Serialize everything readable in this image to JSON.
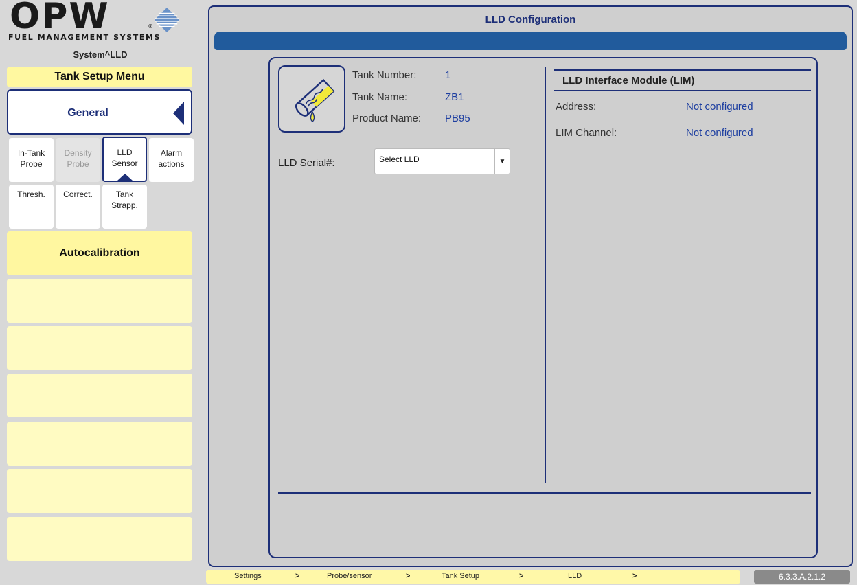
{
  "logo": {
    "brand": "OPW",
    "tagline": "FUEL MANAGEMENT SYSTEMS",
    "registered": "®"
  },
  "sidebar": {
    "system_path": "System^LLD",
    "menu_title": "Tank Setup Menu",
    "general_label": "General",
    "tabs": [
      {
        "line1": "In-Tank",
        "line2": "Probe",
        "state": "normal"
      },
      {
        "line1": "Density",
        "line2": "Probe",
        "state": "disabled"
      },
      {
        "line1": "LLD",
        "line2": "Sensor",
        "state": "active"
      },
      {
        "line1": "Alarm",
        "line2": "actions",
        "state": "normal"
      },
      {
        "line1": "Thresh.",
        "line2": "",
        "state": "normal"
      },
      {
        "line1": "Correct.",
        "line2": "",
        "state": "normal"
      },
      {
        "line1": "Tank",
        "line2": "Strapp.",
        "state": "normal"
      }
    ],
    "autocalibration_label": "Autocalibration",
    "empty_buttons": [
      "",
      "",
      "",
      "",
      "",
      ""
    ]
  },
  "main": {
    "title": "LLD Configuration",
    "tank": {
      "number_label": "Tank Number:",
      "number_value": "1",
      "name_label": "Tank Name:",
      "name_value": "ZB1",
      "product_label": "Product Name:",
      "product_value": "PB95"
    },
    "serial": {
      "label": "LLD Serial#:",
      "selected": "Select LLD"
    },
    "lim": {
      "title": "LLD Interface Module (LIM)",
      "address_label": "Address:",
      "address_value": "Not configured",
      "channel_label": "LIM Channel:",
      "channel_value": "Not configured"
    }
  },
  "breadcrumb": {
    "items": [
      "Settings",
      "Probe/sensor",
      "Tank Setup",
      "LLD"
    ],
    "separator": ">"
  },
  "version": "6.3.3.A.2.1.2",
  "colors": {
    "accent": "#1d2f78",
    "title_bar": "#215b9c",
    "value_text": "#1d3ea0",
    "menu_yellow": "#fff8a0",
    "button_yellow": "#fffbc2"
  },
  "icons": {
    "tank": "tank-pipe-icon",
    "general_arrow": "triangle-left-icon",
    "dropdown": "triangle-down-icon"
  }
}
